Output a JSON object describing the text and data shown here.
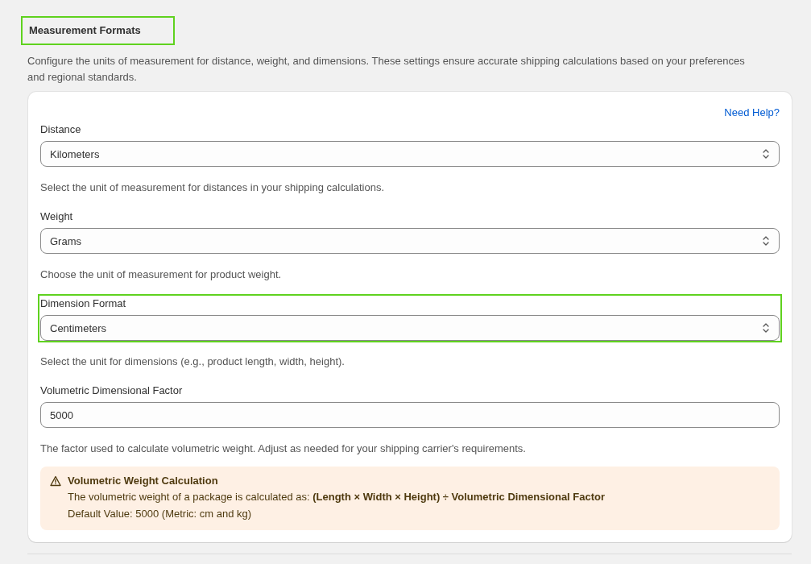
{
  "section": {
    "title": "Measurement Formats",
    "highlighted": true,
    "description": "Configure the units of measurement for distance, weight, and dimensions. These settings ensure accurate shipping calculations based on your preferences and regional standards."
  },
  "card": {
    "help_link": "Need Help?",
    "fields": [
      {
        "kind": "select",
        "label": "Distance",
        "value": "Kilometers",
        "help": "Select the unit of measurement for distances in your shipping calculations.",
        "highlighted": false
      },
      {
        "kind": "select",
        "label": "Weight",
        "value": "Grams",
        "help": "Choose the unit of measurement for product weight.",
        "highlighted": false
      },
      {
        "kind": "select",
        "label": "Dimension Format",
        "value": "Centimeters",
        "help": "Select the unit for dimensions (e.g., product length, width, height).",
        "highlighted": true
      },
      {
        "kind": "input",
        "label": "Volumetric Dimensional Factor",
        "value": "5000",
        "help": "The factor used to calculate volumetric weight. Adjust as needed for your shipping carrier's requirements.",
        "highlighted": false
      }
    ],
    "callout": {
      "kind": "warning",
      "title": "Volumetric Weight Calculation",
      "lines": [
        "The volumetric weight of a package is calculated as: **(Length × Width × Height) ÷ Volumetric Dimensional Factor**",
        "Default Value: 5000 (Metric: cm and kg)"
      ]
    }
  }
}
